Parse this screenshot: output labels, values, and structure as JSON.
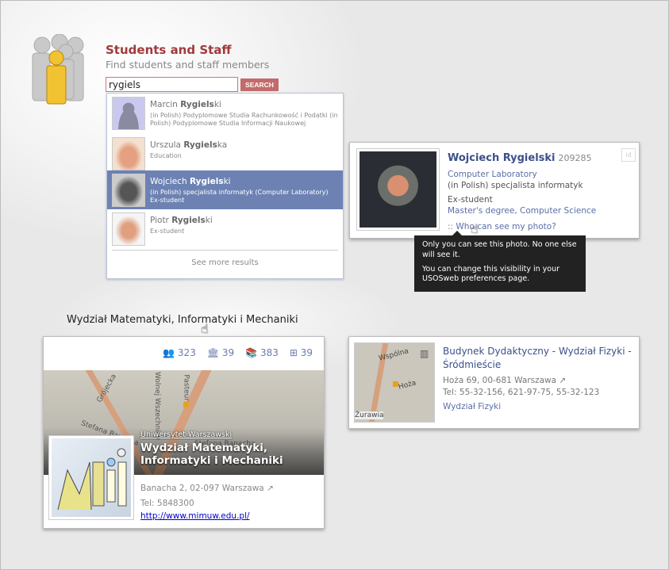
{
  "header": {
    "title": "Students and Staff",
    "subtitle": "Find students and staff members",
    "search_value": "rygiels",
    "search_button": "SEARCH"
  },
  "dropdown": {
    "results": [
      {
        "first": "Marcin ",
        "bold": "Rygiels",
        "rest": "ki",
        "desc": "(in Polish) Podyplomowe Studia Rachunkowość i Podatki (in Polish) Podyplomowe Studia Informacji Naukowej"
      },
      {
        "first": "Urszula ",
        "bold": "Rygiels",
        "rest": "ka",
        "desc": "Education"
      },
      {
        "first": "Wojciech ",
        "bold": "Rygiels",
        "rest": "ki",
        "desc": "(in Polish) specjalista informatyk (Computer Laboratory) Ex-student",
        "selected": true
      },
      {
        "first": "Piotr ",
        "bold": "Rygiels",
        "rest": "ki",
        "desc": "Ex-student"
      }
    ],
    "see_more": "See more results"
  },
  "person_card": {
    "name": "Wojciech Rygielski",
    "id": "209285",
    "id_badge": "id",
    "unit": "Computer Laboratory",
    "position": "(in Polish) specjalista informatyk",
    "status": "Ex-student",
    "program": "Master's degree, Computer Science",
    "photo_prefix": "::",
    "photo_link": "Who can see my photo?"
  },
  "tooltip": {
    "line1": "Only you can see this photo. No one else will see it.",
    "line2": "You can change this visibility in your USOSweb preferences page."
  },
  "faculty_label": "Wydział Matematyki, Informatyki i Mechaniki",
  "faculty_card": {
    "stats": [
      {
        "icon": "people-icon",
        "value": "323"
      },
      {
        "icon": "institution-icon",
        "value": "39"
      },
      {
        "icon": "books-icon",
        "value": "383"
      },
      {
        "icon": "hierarchy-icon",
        "value": "39"
      }
    ],
    "university": "Uniwersytet Warszawski",
    "title": "Wydział Matematyki, Informatyki i Mechaniki",
    "address": "Banacha 2, 02-097 Warszawa",
    "tel": "Tel: 5848300",
    "url": "http://www.mimuw.edu.pl/",
    "map_labels": [
      "Grójecka",
      "Wolnej Wszechnicy",
      "Pasteura",
      "Stefana Banacha",
      "Stefana Banacha"
    ]
  },
  "building_card": {
    "title": "Budynek Dydaktyczny - Wydział Fizyki - Śródmieście",
    "address": "Hoża 69, 00-681 Warszawa",
    "tel": "Tel: 55-32-156, 621-97-75, 55-32-123",
    "faculty": "Wydział Fizyki",
    "map_labels": [
      "Wspólna",
      "Hoża",
      "Żurawia"
    ]
  },
  "colors": {
    "title": "#a13a3a",
    "button": "#c46a6a",
    "selected": "#6d82b3",
    "link": "#5a6fa8"
  }
}
